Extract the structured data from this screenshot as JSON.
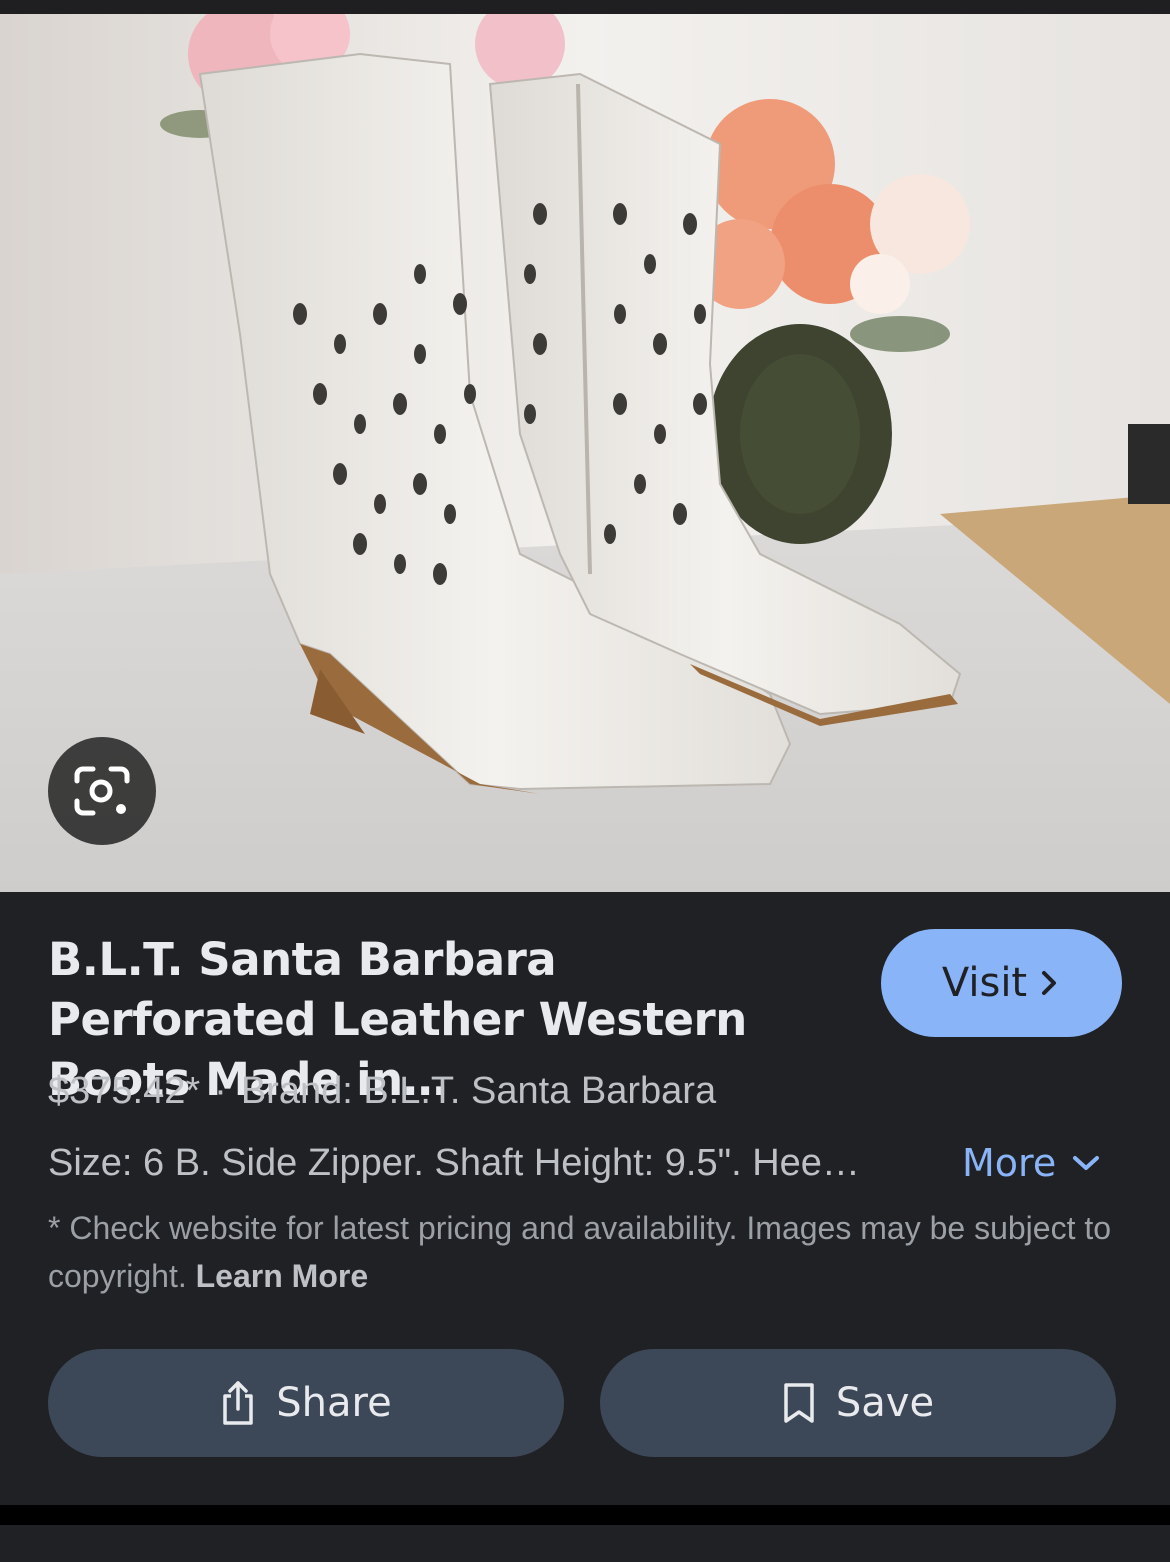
{
  "result": {
    "title": "B.L.T. Santa Barbara Perforated Leather Western Boots Made in…",
    "price": "$375.42*",
    "separator": "·",
    "brand": "Brand: B.L.T. Santa Barbara",
    "description": "Size: 6 B. Side Zipper. Shaft Height: 9.5\". Hee…",
    "more_label": "More",
    "disclaimer": "* Check website for latest pricing and availability. Images may be subject to copyright.",
    "learn_more": "Learn More"
  },
  "buttons": {
    "visit_label": "Visit",
    "share_label": "Share",
    "save_label": "Save"
  },
  "icons": {
    "lens": "google-lens-icon",
    "visit": "chevron-right-icon",
    "more": "chevron-down-icon",
    "share": "share-icon",
    "save": "bookmark-icon"
  },
  "colors": {
    "background": "#202124",
    "accent": "#8ab4f8",
    "button": "#3c4757"
  }
}
